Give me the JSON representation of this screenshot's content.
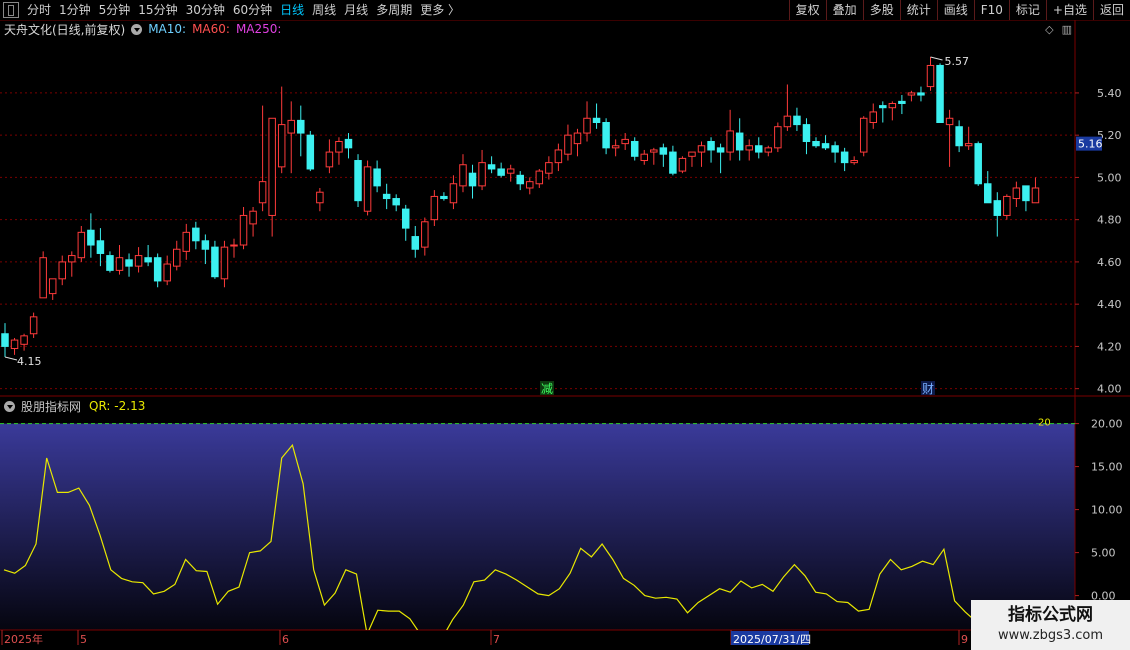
{
  "toolbar": {
    "left_items": [
      "分时",
      "1分钟",
      "5分钟",
      "15分钟",
      "30分钟",
      "60分钟",
      "日线",
      "周线",
      "月线",
      "多周期",
      "更多 〉"
    ],
    "active": "日线",
    "right_items": [
      "复权",
      "叠加",
      "多股",
      "统计",
      "画线",
      "F10",
      "标记",
      "+自选",
      "返回"
    ]
  },
  "main_chart": {
    "title": "天舟文化(日线,前复权)",
    "ma10": "MA10:",
    "ma60": "MA60:",
    "ma250": "MA250:",
    "high_label": "5.57",
    "low_label": "4.15",
    "current_price": "5.16",
    "marker_jian": "减",
    "marker_cai": "财"
  },
  "indicator": {
    "name": "股朋指标网",
    "value_text": "QR: -2.13",
    "line_label": "20"
  },
  "date_axis": {
    "labels": [
      "2025年",
      "5",
      "6",
      "7",
      "2025/07/31/四",
      "9"
    ]
  },
  "watermark": {
    "line1": "指标公式网",
    "line2": "www.zbgs3.com"
  },
  "colors": {
    "up": "#ff3b3b",
    "down": "#3cf0f0",
    "grid": "#7a0000",
    "qr_line": "#e8e800",
    "price_box": "#1a3aa0"
  },
  "chart_data": [
    {
      "type": "candlestick",
      "title": "天舟文化(日线,前复权)",
      "y_ticks": [
        "5.40",
        "5.20",
        "5.00",
        "4.80",
        "4.60",
        "4.40",
        "4.20",
        "4.00"
      ],
      "ylim": [
        3.97,
        5.66
      ],
      "candles": [
        [
          4.26,
          4.31,
          4.15,
          4.2
        ],
        [
          4.19,
          4.24,
          4.16,
          4.23
        ],
        [
          4.21,
          4.26,
          4.18,
          4.25
        ],
        [
          4.26,
          4.36,
          4.24,
          4.34
        ],
        [
          4.43,
          4.65,
          4.43,
          4.62
        ],
        [
          4.45,
          4.52,
          4.42,
          4.52
        ],
        [
          4.52,
          4.63,
          4.49,
          4.6
        ],
        [
          4.6,
          4.65,
          4.53,
          4.63
        ],
        [
          4.62,
          4.77,
          4.6,
          4.74
        ],
        [
          4.75,
          4.83,
          4.62,
          4.68
        ],
        [
          4.7,
          4.76,
          4.58,
          4.64
        ],
        [
          4.63,
          4.65,
          4.55,
          4.56
        ],
        [
          4.56,
          4.68,
          4.54,
          4.62
        ],
        [
          4.61,
          4.64,
          4.53,
          4.58
        ],
        [
          4.58,
          4.67,
          4.55,
          4.63
        ],
        [
          4.62,
          4.68,
          4.58,
          4.6
        ],
        [
          4.62,
          4.64,
          4.48,
          4.51
        ],
        [
          4.51,
          4.63,
          4.49,
          4.59
        ],
        [
          4.58,
          4.7,
          4.56,
          4.66
        ],
        [
          4.65,
          4.78,
          4.61,
          4.74
        ],
        [
          4.76,
          4.79,
          4.66,
          4.7
        ],
        [
          4.7,
          4.73,
          4.59,
          4.66
        ],
        [
          4.67,
          4.7,
          4.52,
          4.53
        ],
        [
          4.52,
          4.7,
          4.48,
          4.67
        ],
        [
          4.68,
          4.71,
          4.62,
          4.68
        ],
        [
          4.68,
          4.86,
          4.66,
          4.82
        ],
        [
          4.78,
          4.86,
          4.72,
          4.84
        ],
        [
          4.88,
          5.34,
          4.84,
          4.98
        ],
        [
          4.82,
          5.27,
          4.72,
          5.28
        ],
        [
          5.05,
          5.43,
          5.02,
          5.25
        ],
        [
          5.21,
          5.36,
          5.02,
          5.27
        ],
        [
          5.27,
          5.34,
          5.1,
          5.21
        ],
        [
          5.2,
          5.22,
          5.03,
          5.04
        ],
        [
          4.88,
          4.95,
          4.84,
          4.93
        ],
        [
          5.05,
          5.18,
          5.02,
          5.12
        ],
        [
          5.12,
          5.19,
          5.06,
          5.17
        ],
        [
          5.18,
          5.21,
          5.09,
          5.14
        ],
        [
          5.08,
          5.11,
          4.86,
          4.89
        ],
        [
          4.84,
          5.08,
          4.82,
          5.05
        ],
        [
          5.04,
          5.08,
          4.93,
          4.96
        ],
        [
          4.92,
          4.97,
          4.85,
          4.9
        ],
        [
          4.9,
          4.92,
          4.84,
          4.87
        ],
        [
          4.85,
          4.87,
          4.7,
          4.76
        ],
        [
          4.72,
          4.77,
          4.62,
          4.66
        ],
        [
          4.67,
          4.81,
          4.63,
          4.79
        ],
        [
          4.8,
          4.94,
          4.77,
          4.91
        ],
        [
          4.91,
          4.93,
          4.89,
          4.9
        ],
        [
          4.88,
          5.01,
          4.85,
          4.97
        ],
        [
          4.96,
          5.11,
          4.93,
          5.06
        ],
        [
          5.02,
          5.06,
          4.9,
          4.96
        ],
        [
          4.96,
          5.13,
          4.94,
          5.07
        ],
        [
          5.06,
          5.1,
          5.02,
          5.04
        ],
        [
          5.04,
          5.07,
          5.0,
          5.01
        ],
        [
          5.02,
          5.06,
          4.98,
          5.04
        ],
        [
          5.01,
          5.03,
          4.94,
          4.97
        ],
        [
          4.95,
          5.0,
          4.92,
          4.98
        ],
        [
          4.97,
          5.04,
          4.95,
          5.03
        ],
        [
          5.02,
          5.1,
          4.99,
          5.07
        ],
        [
          5.07,
          5.16,
          5.03,
          5.13
        ],
        [
          5.11,
          5.25,
          5.08,
          5.2
        ],
        [
          5.16,
          5.23,
          5.1,
          5.21
        ],
        [
          5.21,
          5.36,
          5.17,
          5.28
        ],
        [
          5.28,
          5.35,
          5.23,
          5.26
        ],
        [
          5.26,
          5.28,
          5.11,
          5.14
        ],
        [
          5.14,
          5.18,
          5.1,
          5.15
        ],
        [
          5.16,
          5.21,
          5.13,
          5.18
        ],
        [
          5.17,
          5.19,
          5.08,
          5.1
        ],
        [
          5.08,
          5.13,
          5.06,
          5.11
        ],
        [
          5.12,
          5.14,
          5.06,
          5.13
        ],
        [
          5.14,
          5.16,
          5.05,
          5.11
        ],
        [
          5.12,
          5.15,
          5.01,
          5.02
        ],
        [
          5.03,
          5.1,
          5.02,
          5.09
        ],
        [
          5.1,
          5.12,
          5.05,
          5.12
        ],
        [
          5.12,
          5.17,
          5.05,
          5.15
        ],
        [
          5.17,
          5.19,
          5.07,
          5.13
        ],
        [
          5.14,
          5.16,
          5.02,
          5.12
        ],
        [
          5.12,
          5.32,
          5.08,
          5.22
        ],
        [
          5.21,
          5.28,
          5.08,
          5.13
        ],
        [
          5.13,
          5.18,
          5.08,
          5.15
        ],
        [
          5.15,
          5.19,
          5.09,
          5.12
        ],
        [
          5.12,
          5.15,
          5.1,
          5.14
        ],
        [
          5.14,
          5.26,
          5.12,
          5.24
        ],
        [
          5.24,
          5.44,
          5.22,
          5.29
        ],
        [
          5.29,
          5.33,
          5.22,
          5.25
        ],
        [
          5.25,
          5.28,
          5.11,
          5.17
        ],
        [
          5.17,
          5.19,
          5.14,
          5.15
        ],
        [
          5.16,
          5.2,
          5.13,
          5.14
        ],
        [
          5.15,
          5.17,
          5.07,
          5.12
        ],
        [
          5.12,
          5.14,
          5.03,
          5.07
        ],
        [
          5.07,
          5.1,
          5.06,
          5.08
        ],
        [
          5.12,
          5.29,
          5.1,
          5.28
        ],
        [
          5.26,
          5.35,
          5.23,
          5.31
        ],
        [
          5.34,
          5.36,
          5.26,
          5.33
        ],
        [
          5.33,
          5.36,
          5.27,
          5.35
        ],
        [
          5.36,
          5.39,
          5.3,
          5.35
        ],
        [
          5.39,
          5.41,
          5.36,
          5.4
        ],
        [
          5.4,
          5.43,
          5.36,
          5.39
        ],
        [
          5.43,
          5.57,
          5.41,
          5.53
        ],
        [
          5.53,
          5.54,
          5.26,
          5.26
        ],
        [
          5.25,
          5.32,
          5.05,
          5.28
        ],
        [
          5.24,
          5.27,
          5.12,
          5.15
        ],
        [
          5.15,
          5.24,
          5.13,
          5.16
        ],
        [
          5.16,
          5.17,
          4.96,
          4.97
        ],
        [
          4.97,
          5.03,
          4.88,
          4.88
        ],
        [
          4.89,
          4.93,
          4.72,
          4.82
        ],
        [
          4.82,
          4.92,
          4.8,
          4.91
        ],
        [
          4.9,
          4.98,
          4.86,
          4.95
        ],
        [
          4.96,
          4.96,
          4.84,
          4.89
        ],
        [
          4.88,
          5.0,
          4.88,
          4.95
        ]
      ]
    },
    {
      "type": "line",
      "title": "股朋指标网",
      "y_ticks": [
        "20.00",
        "15.00",
        "10.00",
        "5.00",
        "0.00"
      ],
      "ylim": [
        -4,
        21
      ],
      "reference_line": 20,
      "series": [
        {
          "name": "QR",
          "values": [
            3.0,
            2.6,
            3.5,
            6.0,
            16.0,
            12.0,
            12.0,
            12.5,
            10.5,
            7.0,
            3.0,
            2.0,
            1.6,
            1.5,
            0.2,
            0.5,
            1.3,
            4.2,
            2.9,
            2.8,
            -1.0,
            0.5,
            1.0,
            5.0,
            5.2,
            6.3,
            16.0,
            17.5,
            13.0,
            3.0,
            -1.1,
            0.3,
            3.0,
            2.5,
            -4.5,
            -1.7,
            -1.8,
            -1.8,
            -2.7,
            -4.5,
            -6.5,
            -5.0,
            -2.8,
            -1.1,
            1.6,
            1.8,
            3.0,
            2.5,
            1.8,
            1.0,
            0.2,
            0,
            0.8,
            2.6,
            5.5,
            4.5,
            6.0,
            4.2,
            2.0,
            1.2,
            0,
            -0.3,
            -0.2,
            -0.4,
            -2.0,
            -0.8,
            0,
            0.8,
            0.4,
            1.7,
            0.9,
            1.3,
            0.5,
            2.2,
            3.6,
            2.3,
            0.4,
            0.2,
            -0.7,
            -0.8,
            -1.8,
            -1.6,
            2.5,
            4.2,
            3.0,
            3.4,
            4.0,
            3.6,
            5.4,
            -0.6,
            -1.9,
            -3.0,
            -2.6,
            -6.5,
            -6.5,
            -3.3,
            -3.3,
            -2.13
          ]
        }
      ]
    }
  ]
}
